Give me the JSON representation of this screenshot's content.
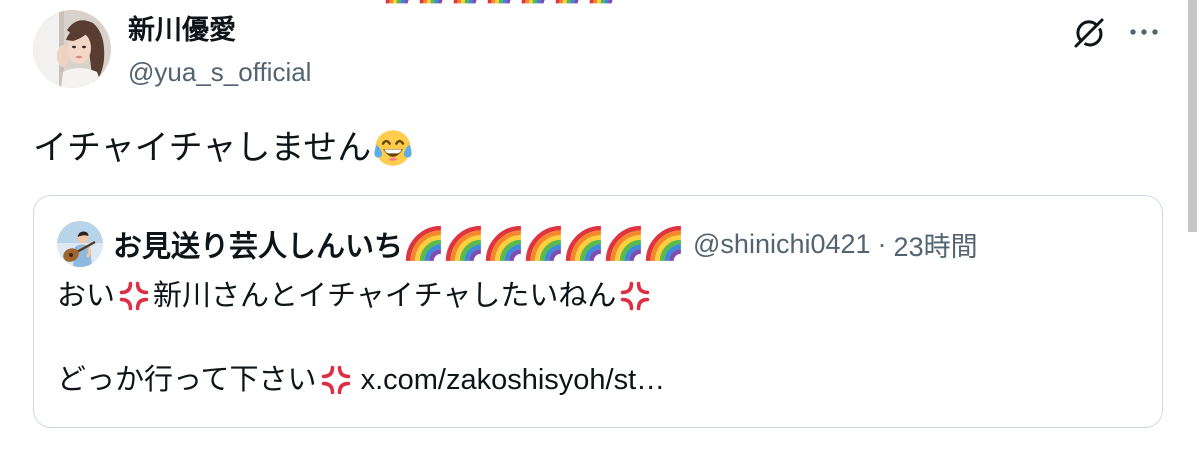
{
  "tweet": {
    "author": {
      "display_name": "新川優愛",
      "handle": "@yua_s_official",
      "avatar": "author-photo-avatar"
    },
    "header_actions": {
      "grok_icon": "grok-icon",
      "more_icon": "more-options-icon"
    },
    "text": "イチャイチャしません",
    "text_emoji": "face-with-tears-of-joy"
  },
  "quote": {
    "author": {
      "display_name": "お見送り芸人しんいち",
      "name_emojis": [
        "rainbow",
        "rainbow",
        "rainbow",
        "rainbow",
        "rainbow",
        "rainbow",
        "rainbow"
      ],
      "handle": "@shinichi0421",
      "separator": "·",
      "timestamp": "23時間",
      "avatar": "guitarist-photo-avatar"
    },
    "lines": [
      {
        "part1": "おい",
        "emoji1": "anger-symbol",
        "part2": "新川さんとイチャイチャしたいねん",
        "emoji2": "anger-symbol"
      },
      {
        "part1": "どっか行って下さい",
        "emoji1": "anger-symbol",
        "link": "x.com/zakoshisyoh/st…"
      }
    ]
  },
  "top_fragment": {
    "emojis": [
      "rainbow",
      "rainbow",
      "rainbow",
      "rainbow",
      "rainbow",
      "rainbow",
      "rainbow"
    ]
  },
  "colors": {
    "text": "#0f1419",
    "secondary_text": "#536471",
    "card_border": "#cfd9de",
    "anger_red": "#dd2e44",
    "scrollbar": "#c7c7c7"
  }
}
